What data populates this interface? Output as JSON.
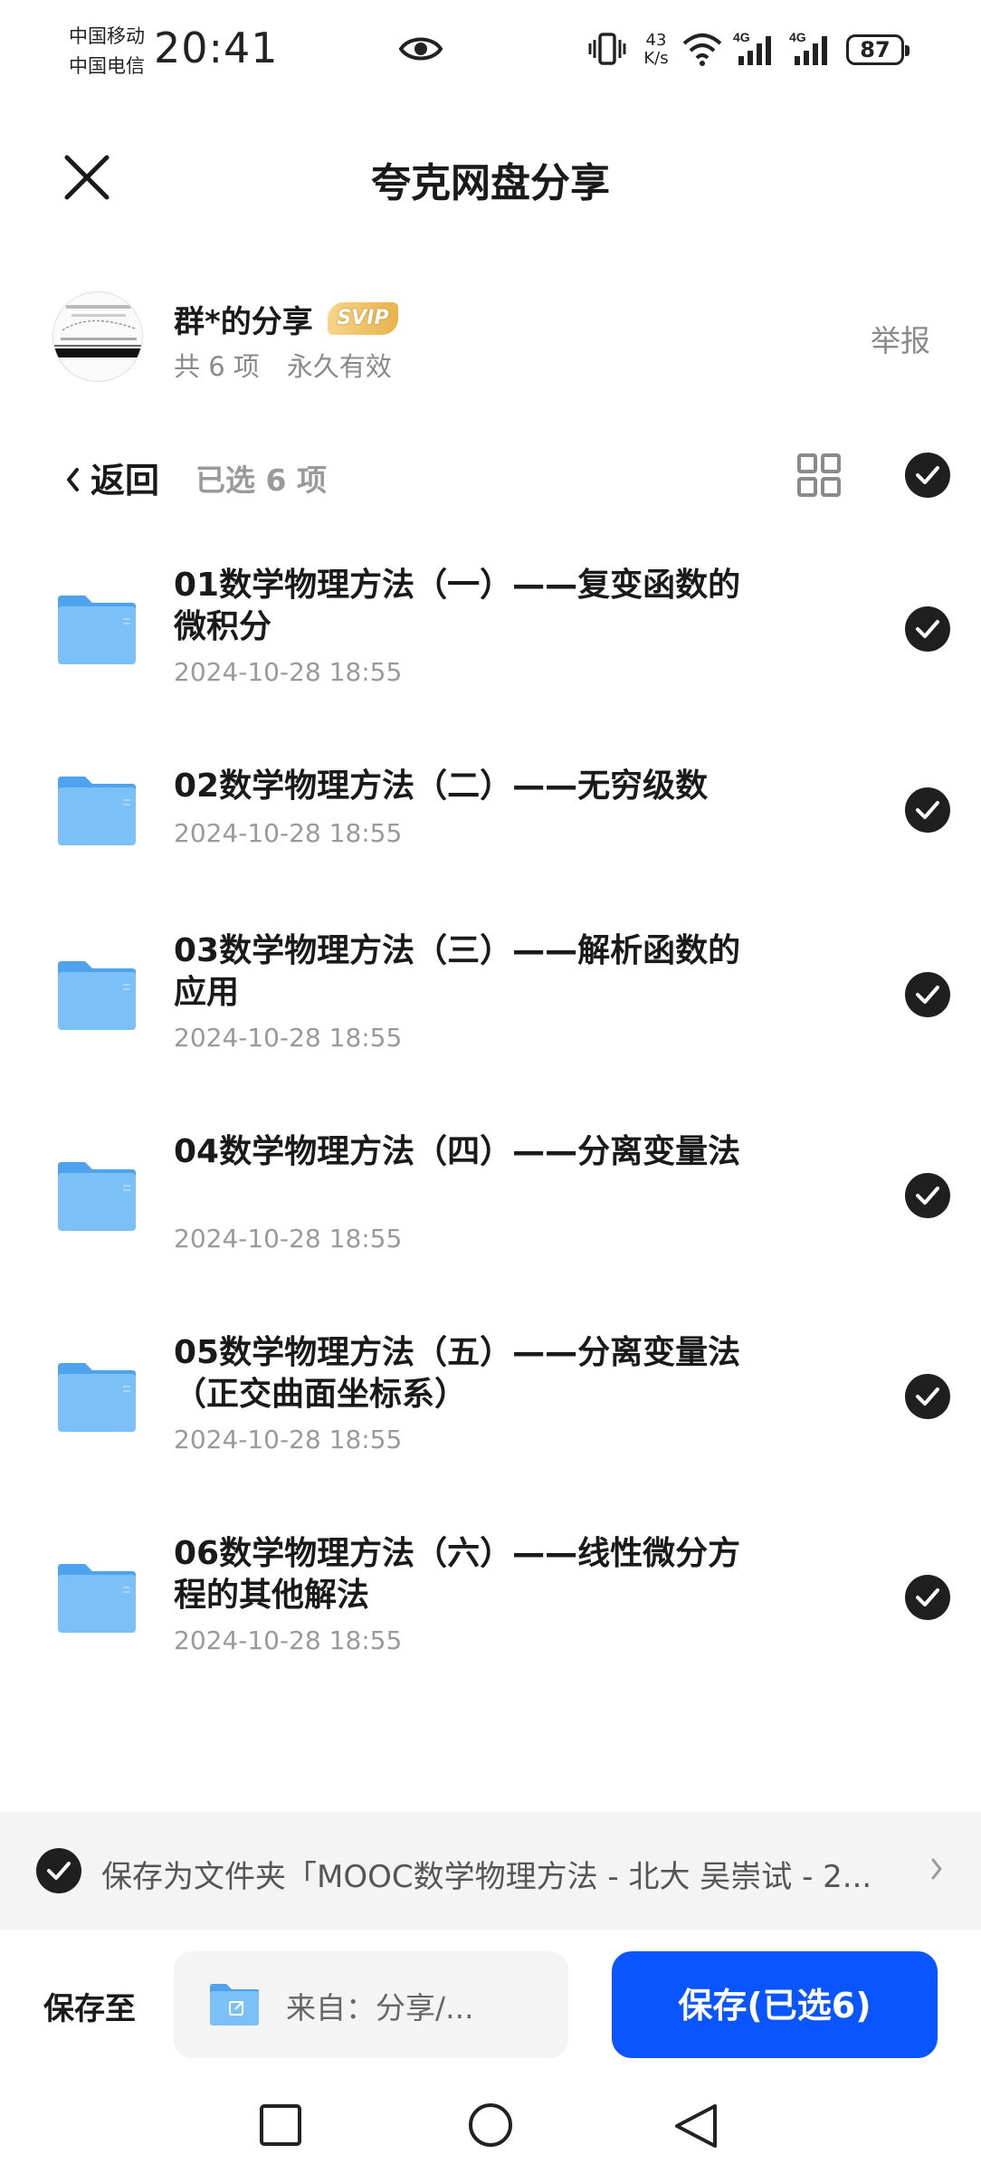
{
  "status_bar": {
    "carrier_1": "中国移动",
    "carrier_2": "中国电信",
    "time": "20:41",
    "net_speed_value": "43",
    "net_speed_unit": "K/s",
    "signal_1_label": "4G",
    "signal_2_label": "4G",
    "battery": "87"
  },
  "header": {
    "title": "夸克网盘分享"
  },
  "sharer": {
    "name": "群*的分享",
    "badge": "SVIP",
    "item_count": "共 6 项",
    "validity": "永久有效",
    "report_label": "举报"
  },
  "toolbar": {
    "back_label": "返回",
    "selected_count": "已选 6 项"
  },
  "files": [
    {
      "name": "01数学物理方法（一）——复变函数的微积分",
      "date": "2024-10-28 18:55"
    },
    {
      "name": "02数学物理方法（二）——无穷级数",
      "date": "2024-10-28 18:55"
    },
    {
      "name": "03数学物理方法（三）——解析函数的应用",
      "date": "2024-10-28 18:55"
    },
    {
      "name": "04数学物理方法（四）——分离变量法",
      "date": "2024-10-28 18:55"
    },
    {
      "name": "05数学物理方法（五）——分离变量法（正交曲面坐标系）",
      "date": "2024-10-28 18:55"
    },
    {
      "name": "06数学物理方法（六）——线性微分方程的其他解法",
      "date": "2024-10-28 18:55"
    }
  ],
  "save_as": {
    "text": "保存为文件夹「MOOC数学物理方法 - 北大 吴崇试 - 2..."
  },
  "bottom": {
    "save_to_label": "保存至",
    "path": "来自：分享/...",
    "save_button": "保存(已选6)"
  },
  "colors": {
    "primary": "#0a55ff",
    "check": "#1f1f1f",
    "folder": "#6db4f5"
  }
}
